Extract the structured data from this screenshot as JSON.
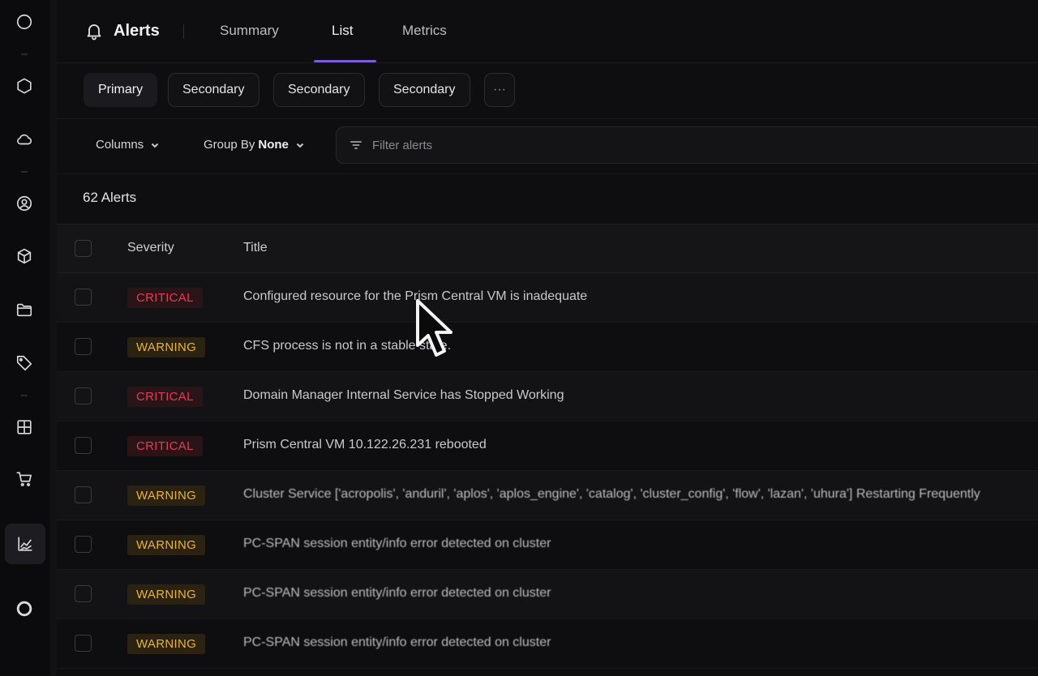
{
  "header": {
    "title": "Alerts",
    "tabs": [
      {
        "label": "Summary"
      },
      {
        "label": "List"
      },
      {
        "label": "Metrics"
      }
    ]
  },
  "buttons": {
    "primary": "Primary",
    "secondary_1": "Secondary",
    "secondary_2": "Secondary",
    "secondary_3": "Secondary",
    "more": "···"
  },
  "toolbar": {
    "columns_label": "Columns",
    "group_by_label": "Group By",
    "group_by_value": "None",
    "filter_placeholder": "Filter alerts"
  },
  "alert_count": "62 Alerts",
  "table": {
    "columns": {
      "severity": "Severity",
      "title": "Title"
    },
    "rows": [
      {
        "severity": "CRITICAL",
        "title": "Configured resource for the Prism Central VM is inadequate"
      },
      {
        "severity": "WARNING",
        "title": "CFS process is not in a stable state."
      },
      {
        "severity": "CRITICAL",
        "title": "Domain Manager Internal Service has Stopped Working"
      },
      {
        "severity": "CRITICAL",
        "title": "Prism Central VM 10.122.26.231 rebooted"
      },
      {
        "severity": "WARNING",
        "title": "Cluster Service ['acropolis', 'anduril', 'aplos', 'aplos_engine', 'catalog', 'cluster_config', 'flow', 'lazan', 'uhura'] Restarting Frequently"
      },
      {
        "severity": "WARNING",
        "title": "PC-SPAN session entity/info error detected on cluster"
      },
      {
        "severity": "WARNING",
        "title": "PC-SPAN session entity/info error detected on cluster"
      },
      {
        "severity": "WARNING",
        "title": "PC-SPAN session entity/info error detected on cluster"
      }
    ]
  },
  "colors": {
    "accent": "#7a5bd8",
    "critical": "#e23d57",
    "warning": "#e8b43a",
    "background": "#0e0e10"
  },
  "rail_icons": [
    "circle-icon",
    "hexagon-icon",
    "cloud-icon",
    "user-circle-icon",
    "cube-icon",
    "folder-icon",
    "tag-icon",
    "grid-icon",
    "cart-icon",
    "chart-icon",
    "ring-icon"
  ]
}
